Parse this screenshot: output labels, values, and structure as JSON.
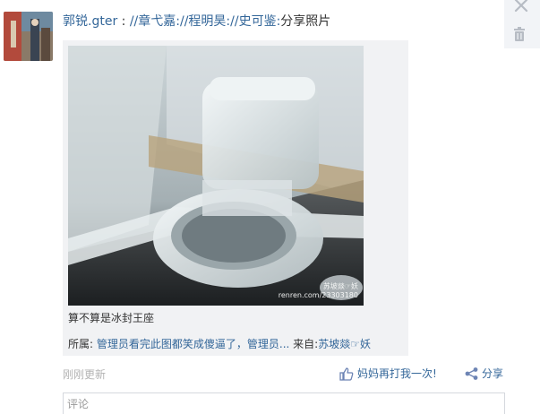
{
  "post": {
    "author": "郭锐.gter",
    "separator": " : ",
    "mention1": "//章弋嘉:",
    "mention2": "//程明昊:",
    "mention3": "//史可鉴:",
    "action": "分享照片"
  },
  "photo": {
    "watermark_title": "苏坡燚☞妖",
    "watermark_url": "renren.com/23303180"
  },
  "caption": "算不算是冰封王座",
  "source": {
    "album_label": "所属:",
    "album_name": "管理员看完此图都笑成傻逼了，管理员...",
    "from_label": "来自:",
    "from_name": "苏坡燚☞妖"
  },
  "footer": {
    "time": "刚刚更新",
    "like_label": "妈妈再打我一次!",
    "share_label": "分享"
  },
  "comment": {
    "placeholder": "评论"
  },
  "icons": {
    "close": "close-icon",
    "delete": "trash-icon",
    "like": "thumbs-up-icon",
    "share": "share-icon"
  }
}
